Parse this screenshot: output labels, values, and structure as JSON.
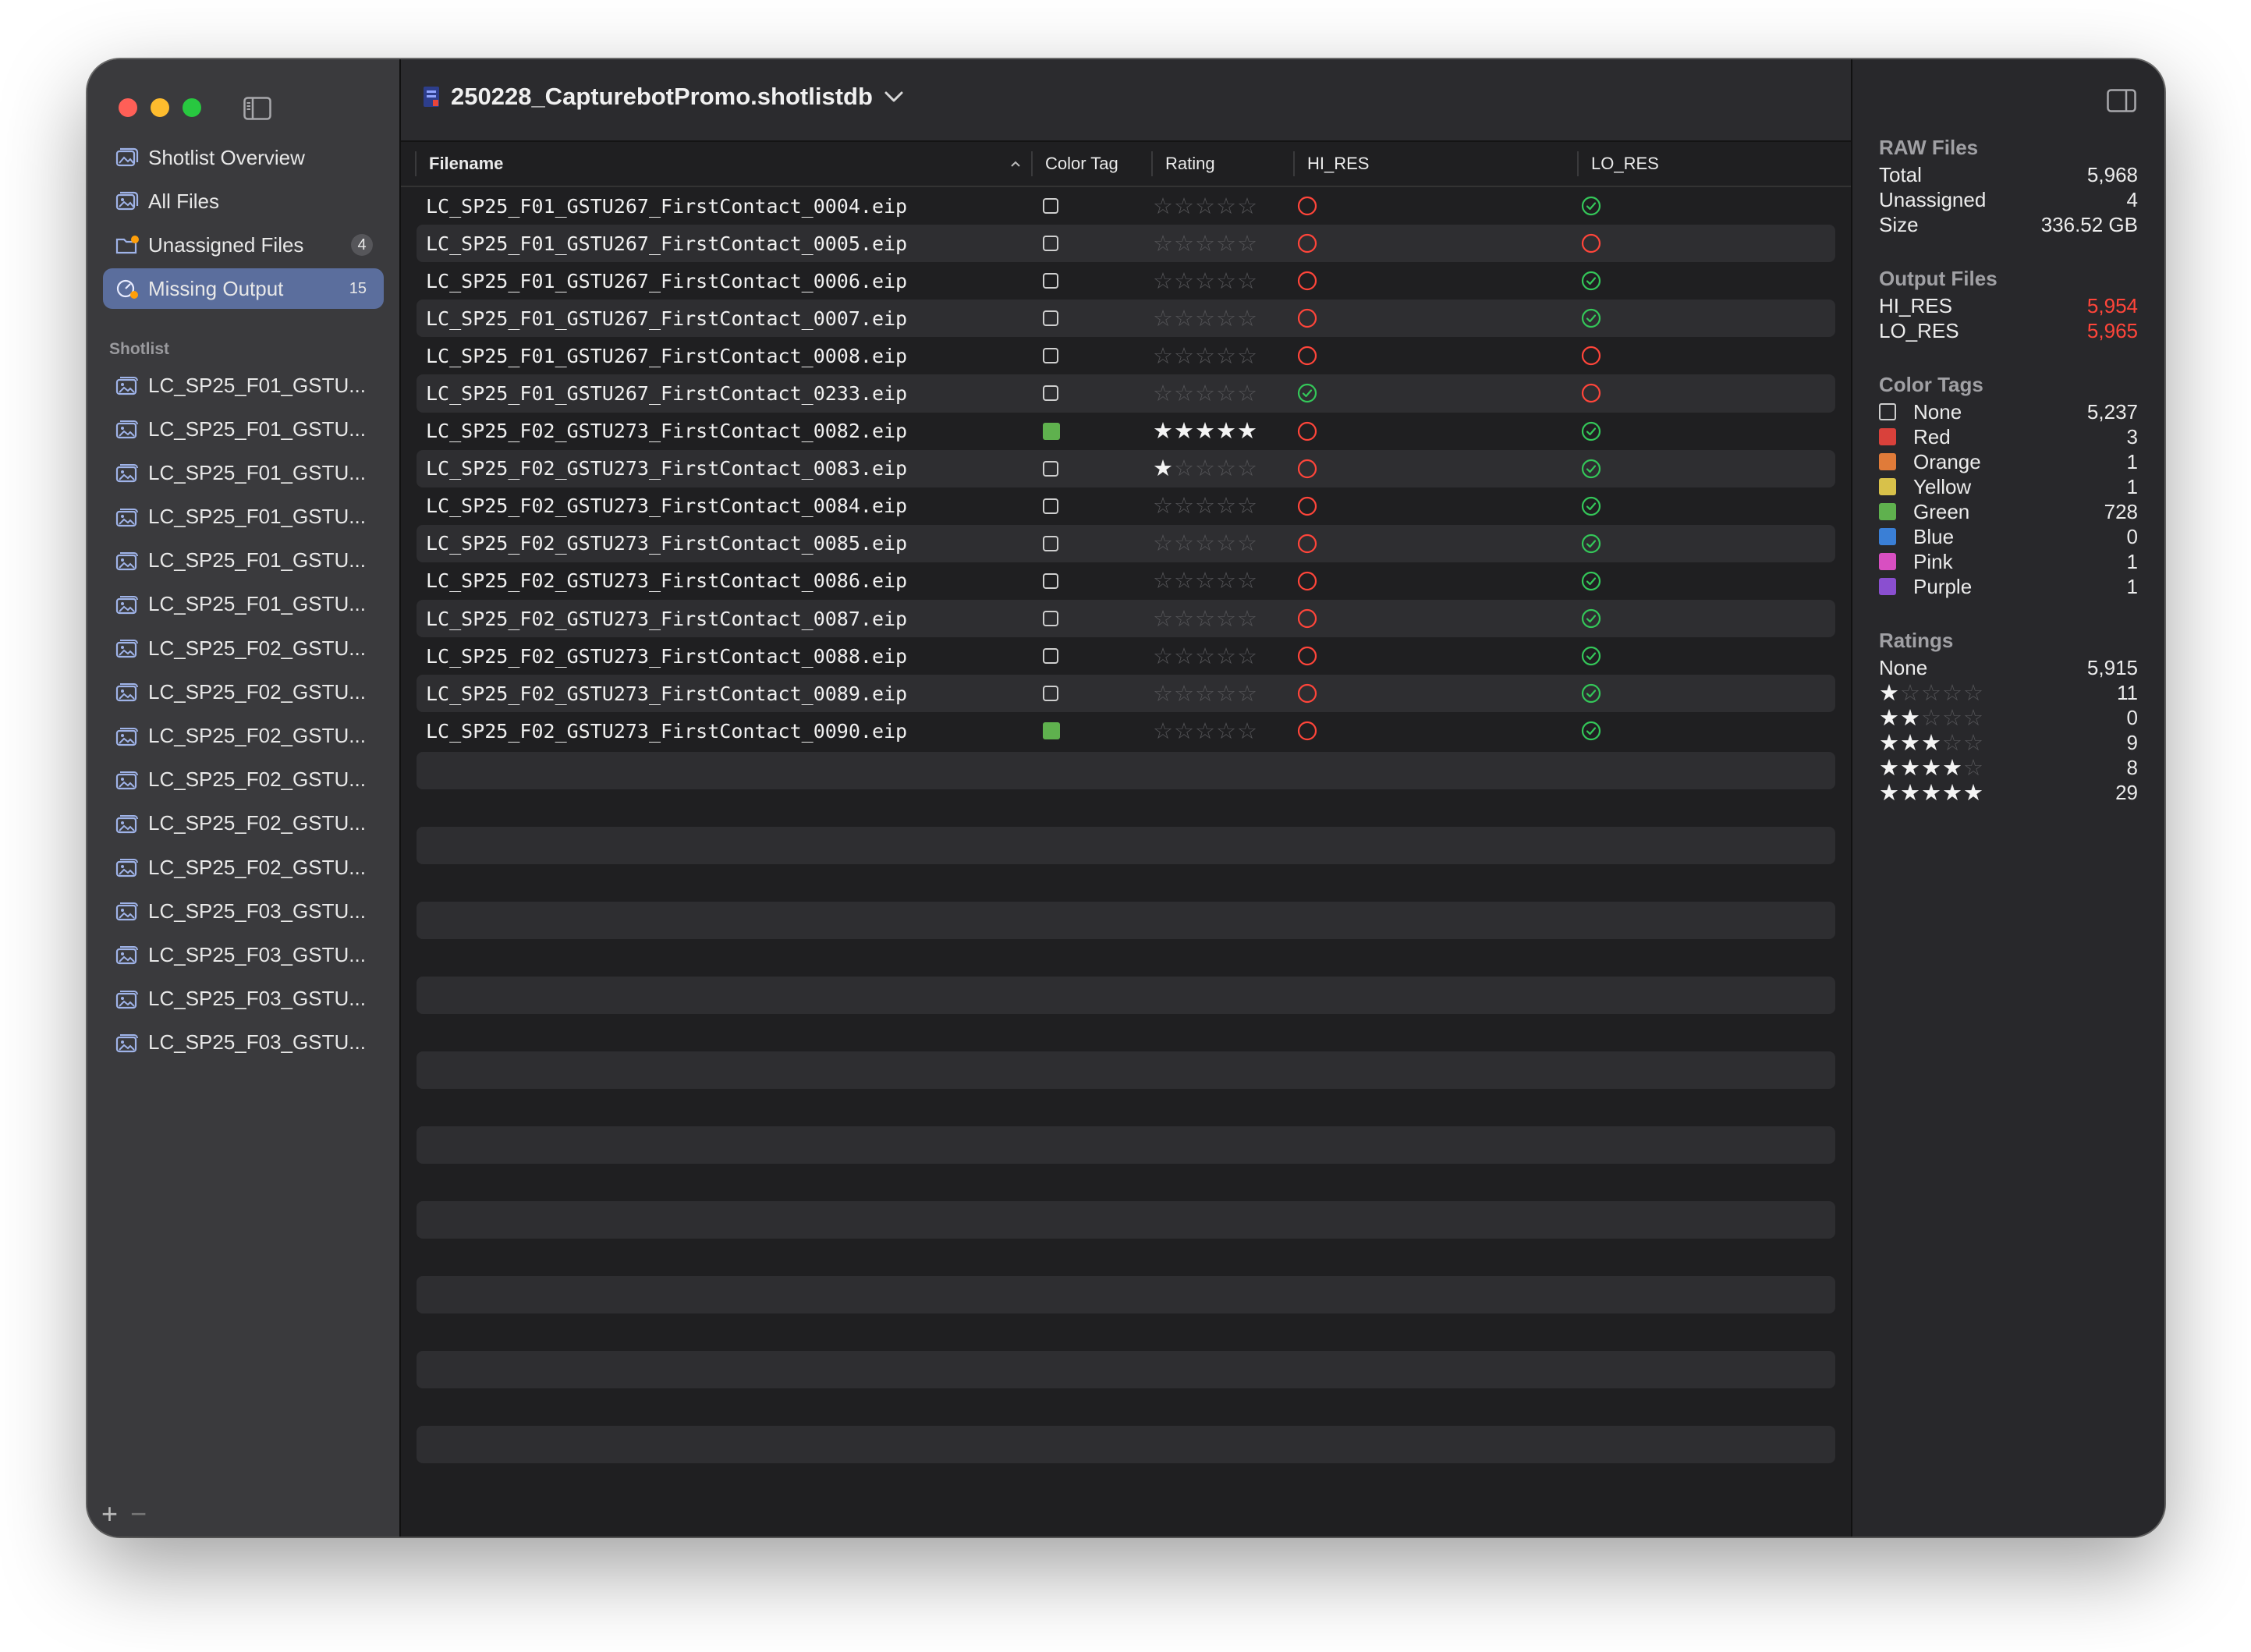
{
  "window": {
    "title": "250228_CapturebotPromo.shotlistdb"
  },
  "sidebar": {
    "nav": [
      {
        "label": "Shotlist Overview",
        "icon": "photo-stack-icon",
        "badge": ""
      },
      {
        "label": "All Files",
        "icon": "photos-icon",
        "badge": ""
      },
      {
        "label": "Unassigned Files",
        "icon": "folder-badge-icon",
        "badge": "4"
      },
      {
        "label": "Missing Output",
        "icon": "gauge-badge-icon",
        "badge": "15",
        "selected": true
      }
    ],
    "section_label": "Shotlist",
    "shotlist": [
      "LC_SP25_F01_GSTU...",
      "LC_SP25_F01_GSTU...",
      "LC_SP25_F01_GSTU...",
      "LC_SP25_F01_GSTU...",
      "LC_SP25_F01_GSTU...",
      "LC_SP25_F01_GSTU...",
      "LC_SP25_F02_GSTU...",
      "LC_SP25_F02_GSTU...",
      "LC_SP25_F02_GSTU...",
      "LC_SP25_F02_GSTU...",
      "LC_SP25_F02_GSTU...",
      "LC_SP25_F02_GSTU...",
      "LC_SP25_F03_GSTU...",
      "LC_SP25_F03_GSTU...",
      "LC_SP25_F03_GSTU...",
      "LC_SP25_F03_GSTU..."
    ],
    "add_label": "+",
    "remove_label": "−"
  },
  "table": {
    "columns": {
      "filename": "Filename",
      "color_tag": "Color Tag",
      "rating": "Rating",
      "hi_res": "HI_RES",
      "lo_res": "LO_RES"
    },
    "rows": [
      {
        "filename": "LC_SP25_F01_GSTU267_FirstContact_0004.eip",
        "color": "none",
        "rating": 0,
        "hi_res": false,
        "lo_res": true
      },
      {
        "filename": "LC_SP25_F01_GSTU267_FirstContact_0005.eip",
        "color": "none",
        "rating": 0,
        "hi_res": false,
        "lo_res": false
      },
      {
        "filename": "LC_SP25_F01_GSTU267_FirstContact_0006.eip",
        "color": "none",
        "rating": 0,
        "hi_res": false,
        "lo_res": true
      },
      {
        "filename": "LC_SP25_F01_GSTU267_FirstContact_0007.eip",
        "color": "none",
        "rating": 0,
        "hi_res": false,
        "lo_res": true
      },
      {
        "filename": "LC_SP25_F01_GSTU267_FirstContact_0008.eip",
        "color": "none",
        "rating": 0,
        "hi_res": false,
        "lo_res": false
      },
      {
        "filename": "LC_SP25_F01_GSTU267_FirstContact_0233.eip",
        "color": "none",
        "rating": 0,
        "hi_res": true,
        "lo_res": false
      },
      {
        "filename": "LC_SP25_F02_GSTU273_FirstContact_0082.eip",
        "color": "green",
        "rating": 5,
        "hi_res": false,
        "lo_res": true
      },
      {
        "filename": "LC_SP25_F02_GSTU273_FirstContact_0083.eip",
        "color": "none",
        "rating": 1,
        "hi_res": false,
        "lo_res": true
      },
      {
        "filename": "LC_SP25_F02_GSTU273_FirstContact_0084.eip",
        "color": "none",
        "rating": 0,
        "hi_res": false,
        "lo_res": true
      },
      {
        "filename": "LC_SP25_F02_GSTU273_FirstContact_0085.eip",
        "color": "none",
        "rating": 0,
        "hi_res": false,
        "lo_res": true
      },
      {
        "filename": "LC_SP25_F02_GSTU273_FirstContact_0086.eip",
        "color": "none",
        "rating": 0,
        "hi_res": false,
        "lo_res": true
      },
      {
        "filename": "LC_SP25_F02_GSTU273_FirstContact_0087.eip",
        "color": "none",
        "rating": 0,
        "hi_res": false,
        "lo_res": true
      },
      {
        "filename": "LC_SP25_F02_GSTU273_FirstContact_0088.eip",
        "color": "none",
        "rating": 0,
        "hi_res": false,
        "lo_res": true
      },
      {
        "filename": "LC_SP25_F02_GSTU273_FirstContact_0089.eip",
        "color": "none",
        "rating": 0,
        "hi_res": false,
        "lo_res": true
      },
      {
        "filename": "LC_SP25_F02_GSTU273_FirstContact_0090.eip",
        "color": "green",
        "rating": 0,
        "hi_res": false,
        "lo_res": true
      }
    ]
  },
  "inspector": {
    "raw_files": {
      "heading": "RAW Files",
      "total_label": "Total",
      "total": "5,968",
      "unassigned_label": "Unassigned",
      "unassigned": "4",
      "size_label": "Size",
      "size": "336.52 GB"
    },
    "output_files": {
      "heading": "Output Files",
      "hi_label": "HI_RES",
      "hi": "5,954",
      "lo_label": "LO_RES",
      "lo": "5,965"
    },
    "color_tags": {
      "heading": "Color Tags",
      "items": [
        {
          "label": "None",
          "count": "5,237",
          "color": ""
        },
        {
          "label": "Red",
          "count": "3",
          "color": "#d9413b"
        },
        {
          "label": "Orange",
          "count": "1",
          "color": "#e07b39"
        },
        {
          "label": "Yellow",
          "count": "1",
          "color": "#d8c14a"
        },
        {
          "label": "Green",
          "count": "728",
          "color": "#5fb14e"
        },
        {
          "label": "Blue",
          "count": "0",
          "color": "#3a7fd6"
        },
        {
          "label": "Pink",
          "count": "1",
          "color": "#d84fc1"
        },
        {
          "label": "Purple",
          "count": "1",
          "color": "#8a4fd0"
        }
      ]
    },
    "ratings": {
      "heading": "Ratings",
      "none_label": "None",
      "none": "5,915",
      "items": [
        {
          "stars": 1,
          "count": "11"
        },
        {
          "stars": 2,
          "count": "0"
        },
        {
          "stars": 3,
          "count": "9"
        },
        {
          "stars": 4,
          "count": "8"
        },
        {
          "stars": 5,
          "count": "29"
        }
      ]
    }
  },
  "colors": {
    "accent": "#5b6e9d",
    "ok": "#34c759",
    "missing": "#ff453a",
    "tag_green": "#5fb14e"
  }
}
